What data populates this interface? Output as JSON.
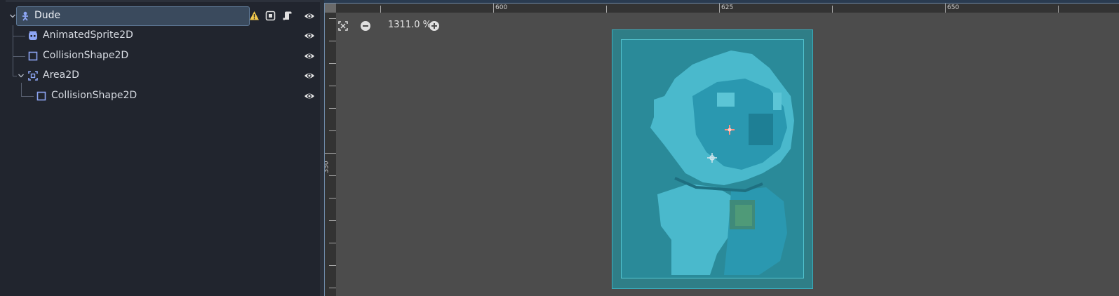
{
  "scene_tree": {
    "nodes": [
      {
        "name": "Dude",
        "icon": "character-body-icon",
        "selected": true
      },
      {
        "name": "AnimatedSprite2D",
        "icon": "animated-sprite-icon"
      },
      {
        "name": "CollisionShape2D",
        "icon": "collision-shape-icon"
      },
      {
        "name": "Area2D",
        "icon": "area2d-icon"
      },
      {
        "name": "CollisionShape2D",
        "icon": "collision-shape-icon"
      }
    ],
    "root_badges": [
      "warning-icon",
      "node-group-icon",
      "script-icon",
      "visibility-eye-icon"
    ]
  },
  "viewport": {
    "zoom_label": "1311.0 %",
    "ruler_h_labels": [
      "600",
      "625",
      "650"
    ],
    "ruler_v_labels": [
      "350"
    ]
  },
  "colors": {
    "accent": "#6e8aa8",
    "selection_bg": "#3a4a5d",
    "warning": "#f2c94c",
    "collision_outline": "#55c7d2",
    "origin_marker": "#ff8f7f"
  }
}
